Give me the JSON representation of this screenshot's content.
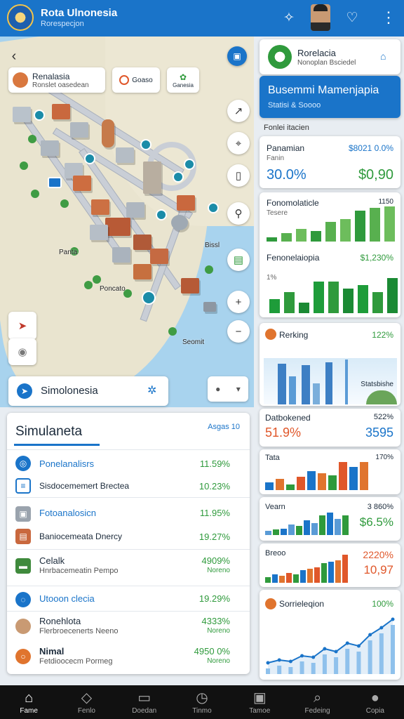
{
  "header": {
    "title": "Rota Ulnonesia",
    "subtitle": "Rorespecjon"
  },
  "map": {
    "chips": [
      {
        "label": "Renalasia",
        "sub": "Ronslet oasedean"
      },
      {
        "label": "Goaso"
      },
      {
        "label": "Ganesia"
      }
    ],
    "labels": [
      "Bissl",
      "Panta",
      "Poncato",
      "Seomit"
    ]
  },
  "search": {
    "label": "Simolonesia"
  },
  "panel": {
    "title": "Simulaneta",
    "badge": "Asgas 10",
    "rows": [
      {
        "label": "Ponelanalisrs",
        "value": "11.59%"
      },
      {
        "label": "Sisdocememert Brectea",
        "value": "10.23%"
      },
      {
        "label": "Fotoanalosicn",
        "value": "11.95%"
      },
      {
        "label": "Baniocemeata Dnercy",
        "value": "19.27%"
      },
      {
        "label": "Celalk",
        "sub": "Hnrbacemeatin Pempo",
        "value": "4909%",
        "valsub": "Noreno"
      },
      {
        "label": "Utooon clecia",
        "value": "19.29%"
      },
      {
        "label": "Ronehlota",
        "sub": "Flerbroecenerts Neeno",
        "value": "4333%",
        "valsub": "Noreno"
      },
      {
        "label": "Nimal",
        "sub": "Fetdioocecm Pormeg",
        "value": "4950 0%",
        "valsub": "Noreno"
      }
    ]
  },
  "sidebar": {
    "brand": {
      "title": "Rorelacia",
      "sub": "Nonoplan Bsciedel"
    },
    "banner": {
      "title": "Busemmi Mamenjapia",
      "sub": "Statisi & Soooo"
    },
    "section": "Fonlei itacien",
    "cards": [
      {
        "title": "Panamian",
        "sub": "Fanin",
        "value": "$8021 0.0%",
        "big": "30.0%",
        "big2": "$0,90"
      },
      {
        "title": "Fonomolaticle",
        "sub": "Tesere",
        "value": "1150",
        "title2": "Fenonelaiopia",
        "value2": "$1,230%",
        "sub2": "1%"
      },
      {
        "title": "Rerking",
        "value": "122%",
        "caption": "Statsbishe"
      },
      {
        "title": "Datbokened",
        "value": "522%",
        "big": "51.9%",
        "big2": "3595"
      },
      {
        "title": "Tata",
        "value": "170%"
      },
      {
        "title": "Vearn",
        "value": "3 860%",
        "big": "$6.5%"
      },
      {
        "title": "Breoo",
        "value": "2220%",
        "big": "10,97"
      },
      {
        "title": "Sorrieleqion",
        "value": "100%"
      }
    ]
  },
  "chart_data": [
    {
      "type": "bar",
      "title": "Fonomolaticle",
      "values": [
        8,
        15,
        22,
        18,
        35,
        40,
        55,
        60,
        62
      ]
    },
    {
      "type": "bar",
      "title": "Fenonelaiopia",
      "values": [
        20,
        30,
        15,
        45,
        45,
        35,
        40,
        30,
        50
      ]
    },
    {
      "type": "bar",
      "title": "Tata",
      "values": [
        8,
        12,
        6,
        14,
        20,
        18,
        16,
        30,
        25,
        30
      ]
    },
    {
      "type": "bar",
      "title": "Vearn",
      "values": [
        6,
        8,
        10,
        16,
        14,
        22,
        18,
        30,
        34,
        24,
        30
      ]
    },
    {
      "type": "bar",
      "title": "Breoo",
      "values": [
        8,
        12,
        10,
        14,
        12,
        18,
        20,
        22,
        28,
        30,
        32,
        40
      ]
    },
    {
      "type": "line",
      "title": "Sorrieleqion",
      "values": [
        10,
        14,
        12,
        20,
        18,
        30,
        26,
        38,
        34,
        50,
        60,
        72
      ]
    }
  ],
  "nav": [
    {
      "label": "Fame",
      "icon": "home-icon"
    },
    {
      "label": "Fenlo",
      "icon": "map-icon"
    },
    {
      "label": "Doedan",
      "icon": "bookmark-icon"
    },
    {
      "label": "Tinmo",
      "icon": "clock-icon"
    },
    {
      "label": "Tamoe",
      "icon": "camera-icon"
    },
    {
      "label": "Fedeing",
      "icon": "search-icon"
    },
    {
      "label": "Copia",
      "icon": "profile-icon"
    }
  ]
}
